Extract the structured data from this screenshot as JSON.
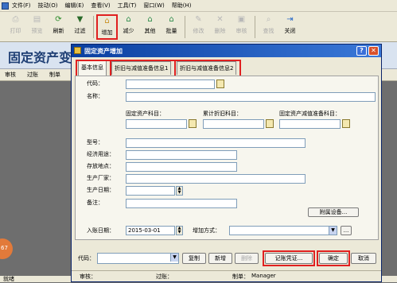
{
  "menu": [
    "文件(F)",
    "技动(O)",
    "编辑(E)",
    "查看(V)",
    "工具(T)",
    "窗口(W)",
    "帮助(H)"
  ],
  "toolbar": [
    {
      "label": "打印",
      "icon": "print-icon",
      "disabled": true
    },
    {
      "label": "预览",
      "icon": "preview-icon",
      "disabled": true
    },
    {
      "label": "刷新",
      "icon": "refresh-icon",
      "disabled": false
    },
    {
      "label": "过滤",
      "icon": "filter-icon",
      "disabled": false
    },
    {
      "label": "增加",
      "icon": "house-add-icon",
      "disabled": false,
      "highlighted": true
    },
    {
      "label": "减少",
      "icon": "house-minus-icon",
      "disabled": false
    },
    {
      "label": "其他",
      "icon": "house-other-icon",
      "disabled": false
    },
    {
      "label": "批量",
      "icon": "house-batch-icon",
      "disabled": false
    },
    {
      "label": "修改",
      "icon": "edit-icon",
      "disabled": true
    },
    {
      "label": "删除",
      "icon": "delete-icon",
      "disabled": true
    },
    {
      "label": "审核",
      "icon": "audit-icon",
      "disabled": true
    },
    {
      "label": "查找",
      "icon": "find-icon",
      "disabled": true
    },
    {
      "label": "关闭",
      "icon": "exit-icon",
      "disabled": false
    }
  ],
  "page_title": "固定资产变",
  "subbar": [
    "审核",
    "过账",
    "制单"
  ],
  "bottom_left": "就绪",
  "circle_text": "67",
  "dialog": {
    "title": "固定资产增加",
    "tabs": [
      "基本信息",
      "折旧与减值准备信息1",
      "折旧与减值准备信息2"
    ],
    "labels": {
      "code": "代码：",
      "name": "名称：",
      "asset_account": "固定资产科目：",
      "dep_account": "累计折旧科目：",
      "imp_account": "固定资产减值准备科目：",
      "model": "型号：",
      "usage": "经济用途：",
      "location": "存放地点：",
      "maker": "生产厂家：",
      "prod_date": "生产日期：",
      "note": "备注：",
      "entry_date": "入账日期：",
      "add_method": "增加方式："
    },
    "entry_date_value": "2015-03-01",
    "accessory_button": "附属设备...",
    "bottom_code_label": "代码：",
    "buttons": {
      "copy": "复制",
      "new": "新增",
      "delete": "删除",
      "voucher": "记账凭证...",
      "ok": "确定",
      "cancel": "取消"
    },
    "status": {
      "audit": "审核：",
      "post": "过账：",
      "maker": "制单：",
      "maker_name": "Manager"
    }
  }
}
